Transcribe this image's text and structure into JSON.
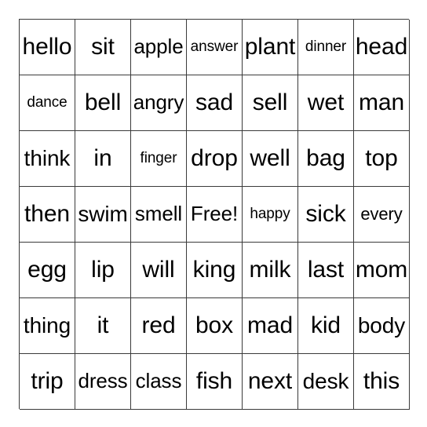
{
  "card": {
    "type": "bingo-card",
    "columns": 7,
    "rows": 7,
    "background_color": "#ffffff",
    "border_color": "#3a3a3a",
    "text_color": "#000000",
    "free_space": {
      "label": "Free!",
      "row": 4,
      "column": 4
    },
    "grid": [
      [
        {
          "text": "hello",
          "size": "xl"
        },
        {
          "text": "sit",
          "size": "xl"
        },
        {
          "text": "apple",
          "size": "md"
        },
        {
          "text": "answer",
          "size": "xs"
        },
        {
          "text": "plant",
          "size": "xl"
        },
        {
          "text": "dinner",
          "size": "xs"
        },
        {
          "text": "head",
          "size": "xl"
        }
      ],
      [
        {
          "text": "dance",
          "size": "xs"
        },
        {
          "text": "bell",
          "size": "xl"
        },
        {
          "text": "angry",
          "size": "md"
        },
        {
          "text": "sad",
          "size": "xl"
        },
        {
          "text": "sell",
          "size": "xl"
        },
        {
          "text": "wet",
          "size": "xl"
        },
        {
          "text": "man",
          "size": "xl"
        }
      ],
      [
        {
          "text": "think",
          "size": "lg"
        },
        {
          "text": "in",
          "size": "xl"
        },
        {
          "text": "finger",
          "size": "xs"
        },
        {
          "text": "drop",
          "size": "xl"
        },
        {
          "text": "well",
          "size": "xl"
        },
        {
          "text": "bag",
          "size": "xl"
        },
        {
          "text": "top",
          "size": "xl"
        }
      ],
      [
        {
          "text": "then",
          "size": "xl"
        },
        {
          "text": "swim",
          "size": "lg"
        },
        {
          "text": "smell",
          "size": "md"
        },
        {
          "text": "Free!",
          "size": "md"
        },
        {
          "text": "happy",
          "size": "xs"
        },
        {
          "text": "sick",
          "size": "xl"
        },
        {
          "text": "every",
          "size": "sm"
        }
      ],
      [
        {
          "text": "egg",
          "size": "xl"
        },
        {
          "text": "lip",
          "size": "xl"
        },
        {
          "text": "will",
          "size": "xl"
        },
        {
          "text": "king",
          "size": "xl"
        },
        {
          "text": "milk",
          "size": "xl"
        },
        {
          "text": "last",
          "size": "xl"
        },
        {
          "text": "mom",
          "size": "xl"
        }
      ],
      [
        {
          "text": "thing",
          "size": "lg"
        },
        {
          "text": "it",
          "size": "xl"
        },
        {
          "text": "red",
          "size": "xl"
        },
        {
          "text": "box",
          "size": "xl"
        },
        {
          "text": "mad",
          "size": "xl"
        },
        {
          "text": "kid",
          "size": "xl"
        },
        {
          "text": "body",
          "size": "lg"
        }
      ],
      [
        {
          "text": "trip",
          "size": "xl"
        },
        {
          "text": "dress",
          "size": "md"
        },
        {
          "text": "class",
          "size": "md"
        },
        {
          "text": "fish",
          "size": "xl"
        },
        {
          "text": "next",
          "size": "xl"
        },
        {
          "text": "desk",
          "size": "lg"
        },
        {
          "text": "this",
          "size": "xl"
        }
      ]
    ]
  }
}
